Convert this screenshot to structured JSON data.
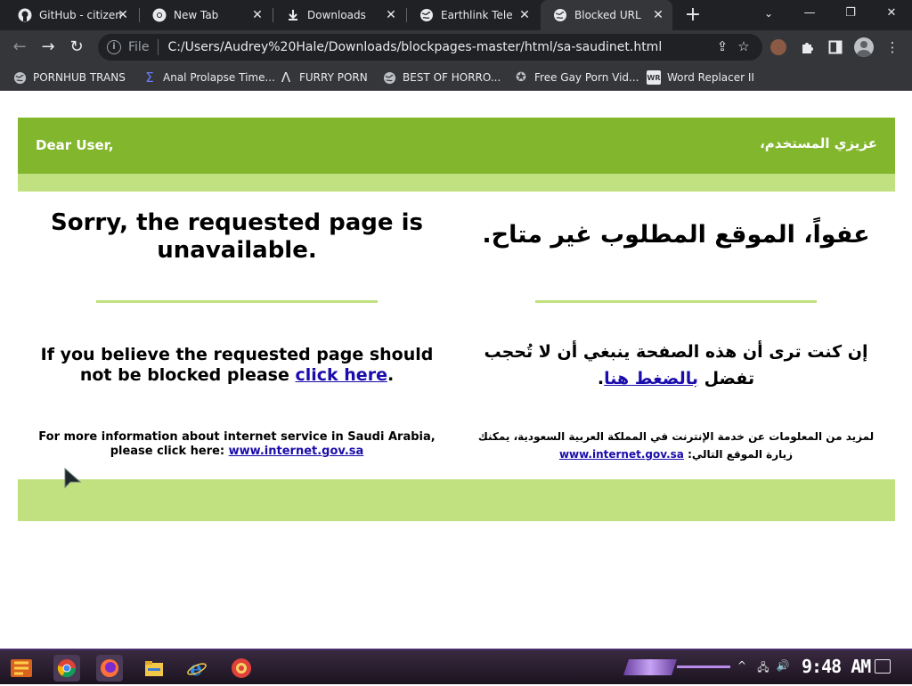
{
  "tabs": [
    {
      "title": "GitHub - citizen",
      "icon": "github-icon"
    },
    {
      "title": "New Tab",
      "icon": "chrome-icon"
    },
    {
      "title": "Downloads",
      "icon": "download-icon"
    },
    {
      "title": "Earthlink Tele",
      "icon": "globe-icon"
    },
    {
      "title": "Blocked URL",
      "icon": "globe-icon",
      "active": true
    }
  ],
  "omnibox": {
    "scheme": "File",
    "url": "C:/Users/Audrey%20Hale/Downloads/blockpages-master/html/sa-saudinet.html"
  },
  "bookmarks": [
    {
      "label": "PORNHUB TRANS",
      "icon": "globe-icon"
    },
    {
      "label": "Anal Prolapse Time...",
      "icon": "sigma-icon"
    },
    {
      "label": "FURRY PORN",
      "icon": "lambda-icon"
    },
    {
      "label": "BEST OF HORRO...",
      "icon": "globe-icon"
    },
    {
      "label": "Free Gay Porn Vid...",
      "icon": "badge-icon"
    },
    {
      "label": "Word Replacer II",
      "icon": "wr-icon"
    }
  ],
  "page": {
    "dear_en": "Dear User,",
    "dear_ar": "عزيزي المستخدم،",
    "sorry_en": "Sorry, the requested page is unavailable.",
    "sorry_ar": "عفواً، الموقع المطلوب غير متاح.",
    "believe_en_pre": "If you believe the requested page should not be blocked please ",
    "believe_en_link": "click here",
    "believe_en_post": ".",
    "believe_ar_pre": "إن كنت ترى أن هذه الصفحة ينبغي أن لا تُحجب تفضل ",
    "believe_ar_link": "بالضغط هنا",
    "believe_ar_post": ".",
    "info_en_pre": "For more information about internet service in Saudi Arabia, please click here: ",
    "info_en_link": "www.internet.gov.sa",
    "info_ar_pre": "لمزيد من المعلومات عن خدمة الإنترنت في المملكة العربية السعودية، يمكنك زيارة الموقع التالي: ",
    "info_ar_link": "www.internet.gov.sa",
    "colors": {
      "header_green": "#82b62c",
      "light_green": "#c1e07f",
      "link_blue": "#1a0dab"
    }
  },
  "taskbar": {
    "apps": [
      "chrome-icon",
      "firefox-icon",
      "file-explorer-icon",
      "internet-explorer-icon",
      "pinterest-like-icon"
    ],
    "clock": "9:48 AM"
  }
}
